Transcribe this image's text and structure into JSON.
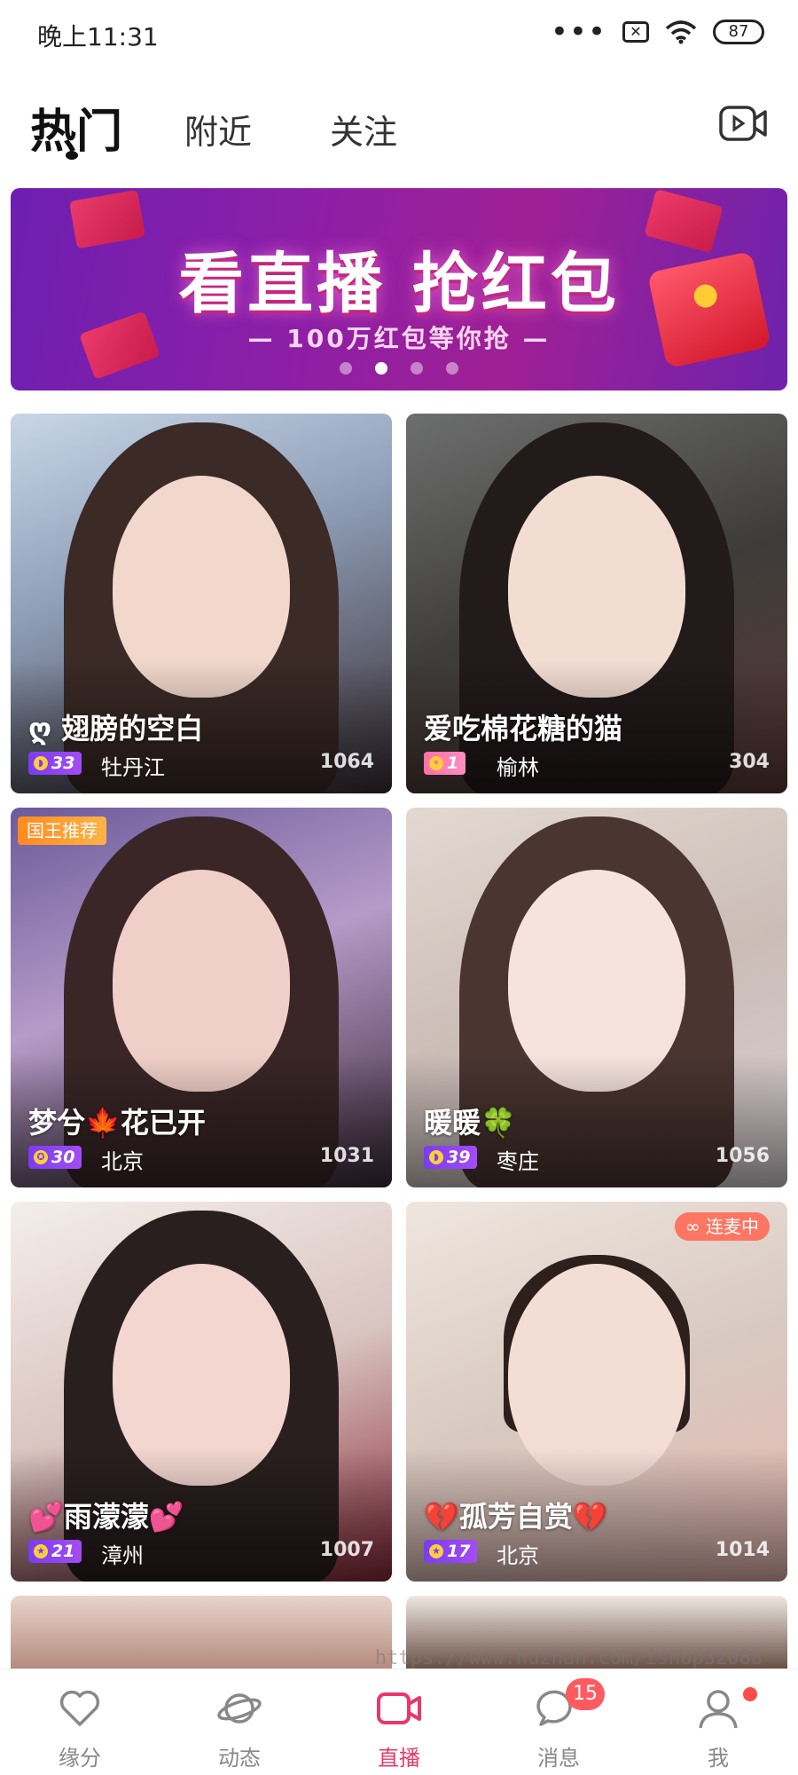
{
  "status_bar": {
    "time": "晚上11:31",
    "battery": "87"
  },
  "top_tabs": {
    "hot": "热门",
    "nearby": "附近",
    "follow": "关注"
  },
  "banner": {
    "title": "看直播 抢红包",
    "subtitle": "— 100万红包等你抢 —"
  },
  "cards": [
    {
      "name": "ღ 翅膀的空白",
      "level": "33",
      "city": "牡丹江",
      "viewers": "1064"
    },
    {
      "name": "爱吃棉花糖的猫",
      "level": "1",
      "city": "榆林",
      "viewers": "304"
    },
    {
      "name": "梦兮🍁花已开",
      "level": "30",
      "city": "北京",
      "viewers": "1031",
      "badge": "国王推荐"
    },
    {
      "name": "暖暖🍀",
      "level": "39",
      "city": "枣庄",
      "viewers": "1056"
    },
    {
      "name": "💕雨濛濛💕",
      "level": "21",
      "city": "漳州",
      "viewers": "1007"
    },
    {
      "name": "💔孤芳自赏💔",
      "level": "17",
      "city": "北京",
      "viewers": "1014",
      "badge": "∞ 连麦中"
    }
  ],
  "bottom_nav": [
    {
      "label": "缘分",
      "icon": "heart-icon"
    },
    {
      "label": "动态",
      "icon": "planet-icon"
    },
    {
      "label": "直播",
      "icon": "video-camera-icon"
    },
    {
      "label": "消息",
      "icon": "chat-bubble-icon",
      "badge": "15"
    },
    {
      "label": "我",
      "icon": "person-icon"
    }
  ],
  "watermark": "https://www.huzhan.com/ishop32088",
  "colors": {
    "accent": "#e8386a",
    "level_purple": "#8b43f2",
    "badge_red": "#ff5a5f"
  }
}
